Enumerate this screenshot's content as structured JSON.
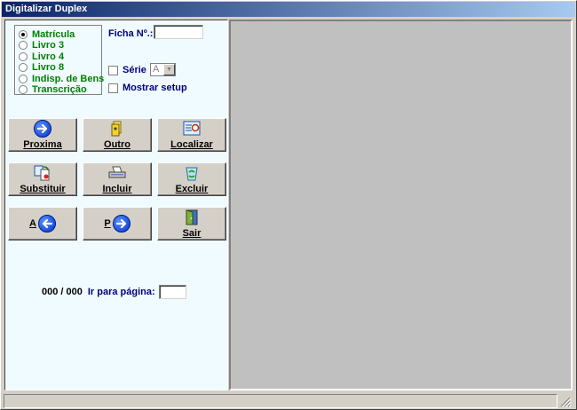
{
  "window": {
    "title": "Digitalizar Duplex"
  },
  "radios": [
    {
      "label": "Matrícula",
      "checked": true
    },
    {
      "label": "Livro 3",
      "checked": false
    },
    {
      "label": "Livro 4",
      "checked": false
    },
    {
      "label": "Livro 8",
      "checked": false
    },
    {
      "label": "Indisp. de Bens",
      "checked": false
    },
    {
      "label": "Transcrição",
      "checked": false
    }
  ],
  "ficha": {
    "label": "Ficha Nº.:",
    "value": ""
  },
  "serie": {
    "label": "Série",
    "checked": false,
    "value": "A"
  },
  "mostrar_setup": {
    "label": "Mostrar setup",
    "checked": false
  },
  "buttons": {
    "proxima": "Proxima",
    "outro": "Outro",
    "localizar": "Localizar",
    "substituir": "Substituir",
    "incluir": "Incluir",
    "excluir": "Excluir",
    "anterior": "A",
    "posterior": "P",
    "sair": "Sair"
  },
  "pager": {
    "count": "000 / 000",
    "go_label": "Ir para página:",
    "page_value": ""
  },
  "icons": {
    "proxima": "arrow-right-circle-icon",
    "outro": "document-stack-icon",
    "localizar": "find-document-icon",
    "substituir": "replace-icon",
    "incluir": "scanner-icon",
    "excluir": "recycle-bin-icon",
    "anterior": "arrow-left-circle-icon",
    "posterior": "arrow-right-circle-icon",
    "sair": "exit-door-icon"
  },
  "colors": {
    "title_start": "#0a246a",
    "title_end": "#a6caf0",
    "panel_bg": "#f0fbff",
    "radio_text": "#008000",
    "label_text": "#00007f",
    "preview_bg": "#c0c0c0"
  }
}
